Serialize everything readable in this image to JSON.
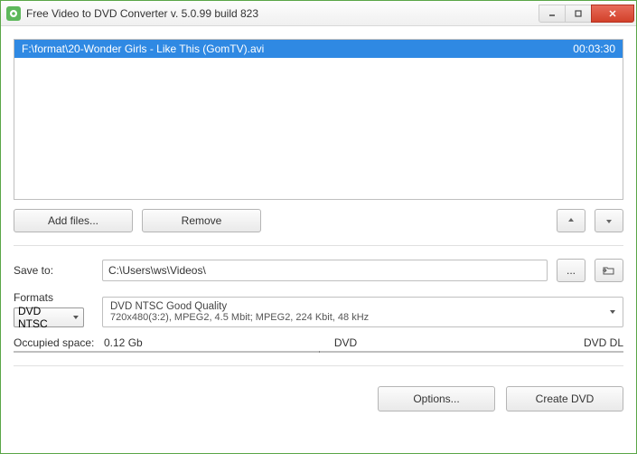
{
  "window": {
    "title": "Free Video to DVD Converter  v. 5.0.99 build 823"
  },
  "filelist": {
    "items": [
      {
        "path": "F:\\format\\20-Wonder Girls - Like This (GomTV).avi",
        "duration": "00:03:30"
      }
    ]
  },
  "buttons": {
    "add_files": "Add files...",
    "remove": "Remove",
    "browse": "...",
    "options": "Options...",
    "create": "Create DVD"
  },
  "labels": {
    "save_to": "Save to:",
    "formats": "Formats",
    "occupied": "Occupied space:",
    "dvd": "DVD",
    "dvd_dl": "DVD DL"
  },
  "save_to": {
    "value": "C:\\Users\\ws\\Videos\\"
  },
  "formats": {
    "preset": "DVD NTSC",
    "quality_title": "DVD NTSC Good Quality",
    "quality_desc": "720x480(3:2), MPEG2, 4.5 Mbit; MPEG2, 224 Kbit, 48 kHz"
  },
  "space": {
    "value": "0.12 Gb",
    "fill_percent": 4.5
  }
}
